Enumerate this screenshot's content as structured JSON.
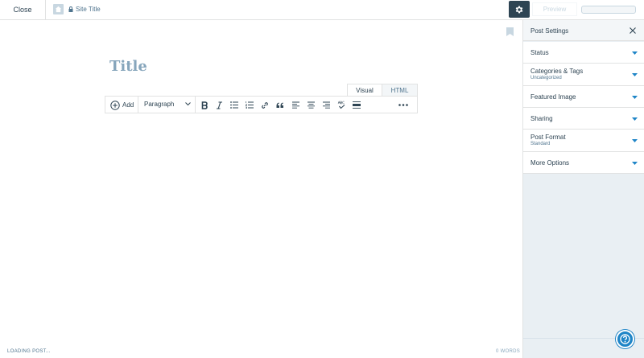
{
  "topbar": {
    "close_label": "Close",
    "site_title": "Site Title",
    "preview_label": "Preview"
  },
  "editor": {
    "title_placeholder": "Title",
    "tabs": [
      {
        "label": "Visual",
        "active": true
      },
      {
        "label": "HTML",
        "active": false
      }
    ],
    "toolbar": {
      "add_label": "Add",
      "format_value": "Paragraph",
      "icons": [
        "bold-icon",
        "italic-icon",
        "bullet-list-icon",
        "numbered-list-icon",
        "link-icon",
        "blockquote-icon",
        "align-left-icon",
        "align-center-icon",
        "align-right-icon",
        "spellcheck-icon",
        "read-more-icon",
        "more-icon"
      ]
    }
  },
  "sidebar": {
    "title": "Post Settings",
    "items": [
      {
        "label": "Status",
        "sub": ""
      },
      {
        "label": "Categories & Tags",
        "sub": "Uncategorized"
      },
      {
        "label": "Featured Image",
        "sub": ""
      },
      {
        "label": "Sharing",
        "sub": ""
      },
      {
        "label": "Post Format",
        "sub": "Standard"
      },
      {
        "label": "More Options",
        "sub": ""
      }
    ]
  },
  "status": {
    "loading": "LOADING POST...",
    "word_count": "0 WORDS"
  },
  "colors": {
    "accent": "#1f85c7",
    "dark": "#2e4453",
    "sidebar_bg": "#e9eff3"
  }
}
